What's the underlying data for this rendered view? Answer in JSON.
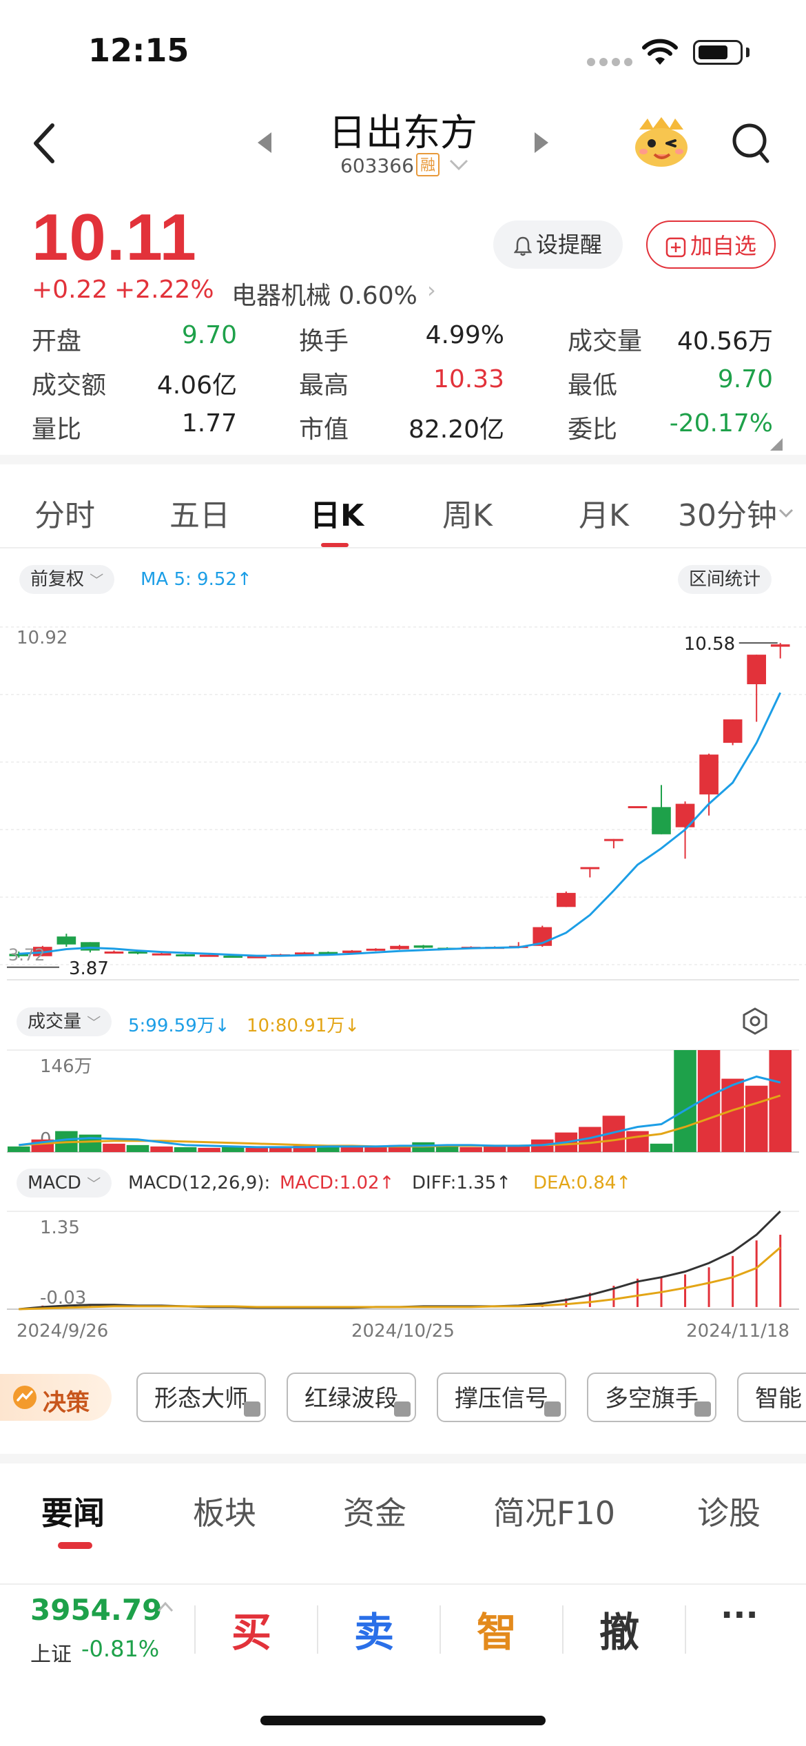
{
  "status_bar": {
    "time": "12:15"
  },
  "header": {
    "name": "日出东方",
    "code": "603366",
    "badge": "融"
  },
  "quote": {
    "price": "10.11",
    "change": "+0.22",
    "change_pct": "+2.22%",
    "sector": "电器机械 0.60%",
    "alert_label": "设提醒",
    "watch_label": "加自选",
    "stats": [
      {
        "label": "开盘",
        "value": "9.70",
        "color": "green"
      },
      {
        "label": "换手",
        "value": "4.99%",
        "color": "neutral"
      },
      {
        "label": "成交量",
        "value": "40.56万",
        "color": "neutral"
      },
      {
        "label": "成交额",
        "value": "4.06亿",
        "color": "neutral"
      },
      {
        "label": "最高",
        "value": "10.33",
        "color": "red"
      },
      {
        "label": "最低",
        "value": "9.70",
        "color": "green"
      },
      {
        "label": "量比",
        "value": "1.77",
        "color": "neutral"
      },
      {
        "label": "市值",
        "value": "82.20亿",
        "color": "neutral"
      },
      {
        "label": "委比",
        "value": "-20.17%",
        "color": "green"
      }
    ]
  },
  "k_tabs": [
    "分时",
    "五日",
    "日K",
    "周K",
    "月K",
    "30分钟"
  ],
  "k_tab_active": "日K",
  "kline": {
    "adjust_label": "前复权",
    "ma_label": "MA 5: 9.52↑",
    "range_stats_label": "区间统计",
    "y_top_label": "10.92",
    "max_label": "10.58",
    "min_label": "3.87",
    "y_low_label": "3.72"
  },
  "volume": {
    "title": "成交量",
    "ma5_label": "5:99.59万↓",
    "ma10_label": "10:80.91万↓",
    "top_label": "146万",
    "zero_label": "0"
  },
  "macd": {
    "title": "MACD",
    "params": "MACD(12,26,9):",
    "macd_label": "MACD:1.02↑",
    "diff_label": "DIFF:1.35↑",
    "dea_label": "DEA:0.84↑",
    "top_label": "1.35",
    "low_label": "-0.03",
    "dates": [
      "2024/9/26",
      "2024/10/25",
      "2024/11/18"
    ]
  },
  "strategy": {
    "label": "决策",
    "buttons": [
      "形态大师",
      "红绿波段",
      "撑压信号",
      "多空旗手",
      "智能"
    ]
  },
  "news_tabs": [
    "要闻",
    "板块",
    "资金",
    "简况F10",
    "诊股"
  ],
  "index": {
    "value": "3954.79",
    "name": "上证",
    "change": "-0.81%"
  },
  "trade": [
    "买",
    "卖",
    "智",
    "撤",
    "···"
  ],
  "colors": {
    "up": "#e2323a",
    "down": "#1ea14a",
    "ma5": "#1c9ee6",
    "ma10": "#e3a516"
  },
  "chart_data": {
    "type": "candlestick",
    "period": "daily",
    "x_start": "2024/9/26",
    "x_end": "2024/11/18",
    "candles": [
      {
        "o": 3.95,
        "c": 3.9,
        "h": 4.0,
        "l": 3.87,
        "up": false
      },
      {
        "o": 3.9,
        "c": 4.1,
        "h": 4.12,
        "l": 3.9,
        "up": true
      },
      {
        "o": 4.15,
        "c": 4.32,
        "h": 4.38,
        "l": 4.1,
        "up": false
      },
      {
        "o": 4.2,
        "c": 4.02,
        "h": 4.2,
        "l": 3.98,
        "up": false
      },
      {
        "o": 4.0,
        "c": 3.98,
        "h": 4.02,
        "l": 3.96,
        "up": true
      },
      {
        "o": 4.0,
        "c": 3.96,
        "h": 4.02,
        "l": 3.94,
        "up": false
      },
      {
        "o": 3.96,
        "c": 3.94,
        "h": 3.97,
        "l": 3.92,
        "up": true
      },
      {
        "o": 3.94,
        "c": 3.93,
        "h": 3.95,
        "l": 3.91,
        "up": false
      },
      {
        "o": 3.93,
        "c": 3.91,
        "h": 3.94,
        "l": 3.9,
        "up": true
      },
      {
        "o": 3.91,
        "c": 3.9,
        "h": 3.92,
        "l": 3.89,
        "up": false
      },
      {
        "o": 3.9,
        "c": 3.88,
        "h": 3.91,
        "l": 3.87,
        "up": true
      },
      {
        "o": 3.9,
        "c": 3.94,
        "h": 3.95,
        "l": 3.89,
        "up": true
      },
      {
        "o": 3.94,
        "c": 3.98,
        "h": 3.99,
        "l": 3.93,
        "up": true
      },
      {
        "o": 3.99,
        "c": 3.96,
        "h": 4.0,
        "l": 3.95,
        "up": false
      },
      {
        "o": 3.97,
        "c": 4.02,
        "h": 4.03,
        "l": 3.96,
        "up": true
      },
      {
        "o": 4.02,
        "c": 4.06,
        "h": 4.07,
        "l": 4.01,
        "up": true
      },
      {
        "o": 4.05,
        "c": 4.12,
        "h": 4.14,
        "l": 4.04,
        "up": true
      },
      {
        "o": 4.13,
        "c": 4.08,
        "h": 4.14,
        "l": 4.06,
        "up": false
      },
      {
        "o": 4.08,
        "c": 4.06,
        "h": 4.09,
        "l": 4.04,
        "up": false
      },
      {
        "o": 4.06,
        "c": 4.1,
        "h": 4.11,
        "l": 4.05,
        "up": true
      },
      {
        "o": 4.1,
        "c": 4.08,
        "h": 4.11,
        "l": 4.07,
        "up": true
      },
      {
        "o": 4.08,
        "c": 4.12,
        "h": 4.2,
        "l": 4.07,
        "up": true
      },
      {
        "o": 4.12,
        "c": 4.52,
        "h": 4.55,
        "l": 4.1,
        "up": true
      },
      {
        "o": 4.95,
        "c": 5.25,
        "h": 5.28,
        "l": 4.95,
        "up": true
      },
      {
        "o": 5.78,
        "c": 5.8,
        "h": 5.8,
        "l": 5.58,
        "up": true
      },
      {
        "o": 6.38,
        "c": 6.4,
        "h": 6.4,
        "l": 6.2,
        "up": true
      },
      {
        "o": 7.08,
        "c": 7.1,
        "h": 7.1,
        "l": 7.08,
        "up": true
      },
      {
        "o": 7.08,
        "c": 6.5,
        "h": 7.55,
        "l": 6.5,
        "up": false
      },
      {
        "o": 6.65,
        "c": 7.15,
        "h": 7.2,
        "l": 5.98,
        "up": true
      },
      {
        "o": 7.35,
        "c": 8.2,
        "h": 8.22,
        "l": 6.9,
        "up": true
      },
      {
        "o": 8.45,
        "c": 8.95,
        "h": 8.95,
        "l": 8.4,
        "up": true
      },
      {
        "o": 9.7,
        "c": 10.33,
        "h": 10.33,
        "l": 8.9,
        "up": true
      },
      {
        "o": 10.5,
        "c": 10.55,
        "h": 10.58,
        "l": 10.25,
        "up": true
      }
    ],
    "ma5": [
      3.95,
      3.98,
      4.05,
      4.08,
      4.06,
      4.02,
      3.99,
      3.97,
      3.95,
      3.93,
      3.91,
      3.91,
      3.92,
      3.93,
      3.95,
      3.98,
      4.01,
      4.03,
      4.05,
      4.07,
      4.08,
      4.09,
      4.18,
      4.4,
      4.78,
      5.3,
      5.85,
      6.2,
      6.6,
      7.15,
      7.6,
      8.45,
      9.52
    ],
    "volume": [
      8,
      18,
      30,
      25,
      12,
      10,
      8,
      7,
      6,
      7,
      6,
      8,
      9,
      7,
      8,
      9,
      10,
      14,
      9,
      7,
      8,
      9,
      18,
      28,
      36,
      52,
      30,
      12,
      146,
      146,
      105,
      95,
      146
    ],
    "volume_up": [
      false,
      true,
      false,
      false,
      true,
      false,
      true,
      false,
      true,
      false,
      true,
      true,
      true,
      false,
      true,
      true,
      true,
      false,
      false,
      true,
      true,
      true,
      true,
      true,
      true,
      true,
      true,
      false,
      false,
      true,
      true,
      true,
      true
    ],
    "vol_ma5": [
      10,
      14,
      18,
      20,
      19,
      18,
      14,
      10,
      9,
      8,
      7,
      7,
      7,
      8,
      8,
      8,
      9,
      9,
      10,
      10,
      9,
      9,
      10,
      14,
      20,
      28,
      36,
      40,
      60,
      80,
      96,
      108,
      99.59
    ],
    "vol_ma10": [
      10,
      12,
      14,
      15,
      16,
      16,
      16,
      15,
      14,
      13,
      12,
      11,
      10,
      9,
      9,
      8,
      8,
      8,
      9,
      9,
      9,
      9,
      10,
      11,
      13,
      17,
      22,
      26,
      36,
      48,
      60,
      70,
      80.91
    ],
    "diff": [
      -0.03,
      0.0,
      0.02,
      0.03,
      0.03,
      0.02,
      0.02,
      0.01,
      0.0,
      0.0,
      -0.01,
      -0.01,
      -0.01,
      -0.01,
      -0.01,
      0.0,
      0.0,
      0.01,
      0.01,
      0.01,
      0.01,
      0.02,
      0.05,
      0.1,
      0.17,
      0.26,
      0.36,
      0.42,
      0.5,
      0.62,
      0.78,
      1.02,
      1.35
    ],
    "dea": [
      -0.03,
      -0.02,
      -0.01,
      0.0,
      0.01,
      0.01,
      0.01,
      0.01,
      0.01,
      0.01,
      0.0,
      0.0,
      0.0,
      0.0,
      0.0,
      0.0,
      0.0,
      0.0,
      0.0,
      0.0,
      0.01,
      0.01,
      0.02,
      0.04,
      0.07,
      0.11,
      0.16,
      0.21,
      0.27,
      0.34,
      0.42,
      0.55,
      0.84
    ],
    "macd_hist": [
      0.0,
      0.02,
      0.03,
      0.02,
      0.01,
      0.01,
      0.01,
      0.0,
      0.0,
      0.0,
      0.0,
      0.0,
      0.0,
      0.0,
      0.0,
      0.0,
      0.0,
      0.0,
      0.0,
      0.0,
      0.0,
      0.01,
      0.06,
      0.12,
      0.2,
      0.3,
      0.4,
      0.42,
      0.46,
      0.56,
      0.72,
      0.94,
      1.02
    ],
    "price_ylim": [
      3.72,
      10.92
    ],
    "volume_ylim": [
      0,
      146
    ],
    "macd_ylim": [
      -0.03,
      1.35
    ]
  }
}
